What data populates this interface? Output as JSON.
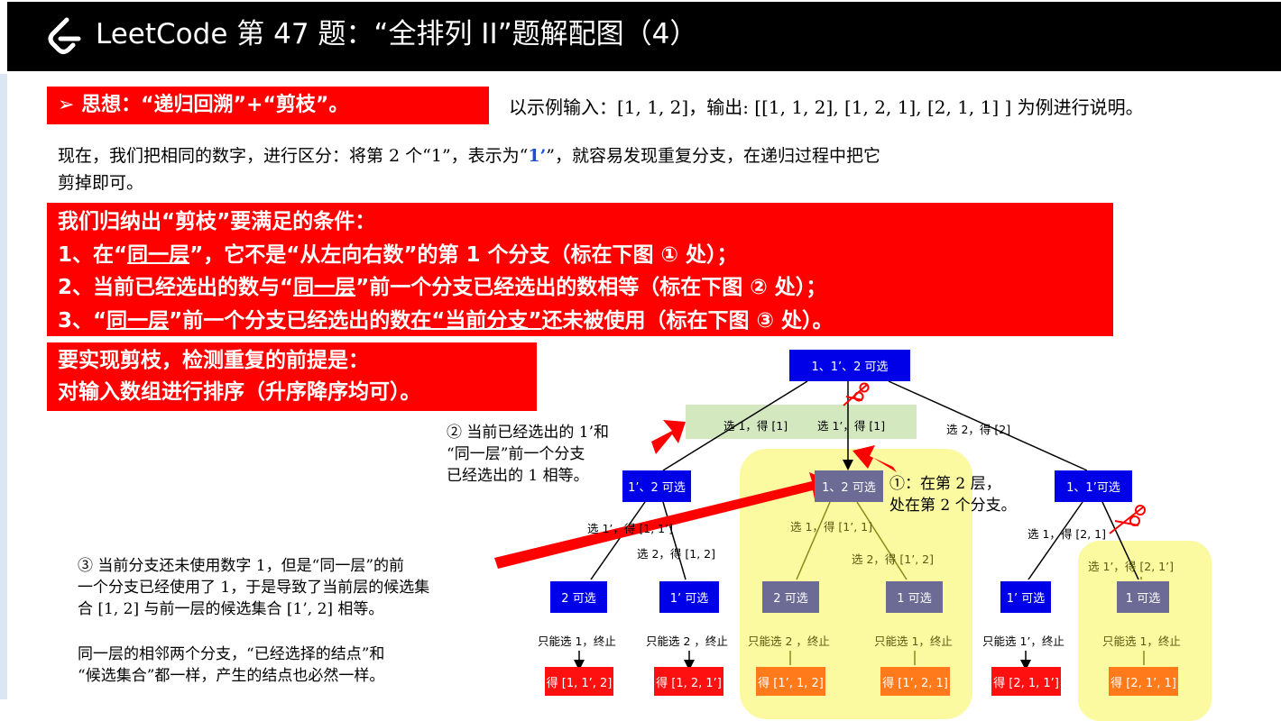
{
  "header": {
    "title": "LeetCode 第 47 题：“全排列 II”题解配图（4）"
  },
  "idea_box": {
    "text": "➢  思想：“递归回溯”+“剪枝”。"
  },
  "example_text": "以示例输入：[1, 1, 2]，输出: [[1, 1, 2],  [1, 2, 1],  [2, 1, 1] ] 为例进行说明。",
  "intro": {
    "line1_a": "现在，我们把相同的数字，进行区分：将第 2 个“1”，表示为“",
    "line1_highlight": "1’",
    "line1_b": "”，就容易发现重复分支，在递归过程中把它",
    "line2": "剪掉即可。"
  },
  "conditions_box": {
    "heading": "我们归纳出“剪枝”要满足的条件：",
    "c1_a": "1、在“",
    "c1_u": "同一层",
    "c1_b": "”，它不是“从左向右数”的第 1 个分支（标在下图 ① 处）；",
    "c2_a": "2、当前已经选出的数与“",
    "c2_u": "同一层",
    "c2_b": "”前一个分支已经选出的数相等（标在下图 ② 处）；",
    "c3_a": "3、“",
    "c3_u1": "同一层",
    "c3_mid": "”前一个分支已经选出的数",
    "c3_u2": "在“当前分支”",
    "c3_b": "还未被使用（标在下图 ③ 处）。"
  },
  "premise_box": {
    "line1": "要实现剪枝，检测重复的前提是：",
    "line2": "对输入数组进行排序（升序降序均可）。"
  },
  "tree": {
    "root": "1、1’、2 可选",
    "level1_edges": [
      "选 1，得 [1]",
      "选 1’，得 [1]",
      "选 2，得 [2]"
    ],
    "level2_nodes": [
      "1’、2 可选",
      "1、2 可选",
      "1、1’可选"
    ],
    "level2_edges": [
      "选 1’，得 [1, 1’]",
      "选 2，得 [1, 2]",
      "选 1，得 [1’, 1]",
      "选 2，得 [1’, 2]",
      "选 1，得 [2, 1]",
      "选 1’，得 [2, 1’]"
    ],
    "level3_nodes": [
      "2 可选",
      "1’ 可选",
      "2 可选",
      "1 可选",
      "1’ 可选",
      "1 可选"
    ],
    "level3_edges": [
      "只能选 1，终止",
      "只能选 2 ，终止",
      "只能选 2 ，终止",
      "只能选 1，终止",
      "只能选 1’，终止",
      "只能选 1，终止"
    ],
    "leaves": [
      "得 [1, 1’, 2]",
      "得 [1, 2, 1’]",
      "得 [1’, 1, 2]",
      "得 [1’, 2, 1]",
      "得 [2, 1, 1’]",
      "得 [2, 1’, 1]"
    ]
  },
  "annotations": {
    "a2_l1": "② 当前已经选出的 1’和",
    "a2_l2": "“同一层”前一个分支",
    "a2_l3": "已经选出的 1 相等。",
    "a1_l1": "①：在第 2 层，",
    "a1_l2": "处在第 2 个分支。",
    "a3_l1": "③ 当前分支还未使用数字 1，但是“同一层”的前",
    "a3_l2": "一个分支已经使用了 1，于是导致了当前层的候选集",
    "a3_l3": "合 [1, 2] 与前一层的候选集合 [1’, 2] 相等。",
    "note_l1": "同一层的相邻两个分支，“已经选择的结点”和",
    "note_l2": "“候选集合”都一样，产生的结点也必然一样。"
  },
  "colors": {
    "header_bg": "#000000",
    "red": "#ff0000",
    "node_blue": "#0000e8",
    "node_grey": "#6b6b96",
    "leaf_orange": "#ff7a1a",
    "highlight_yellow": "#fbfaa0",
    "highlight_green": "#d4e8c0",
    "accent_blue_text": "#1a4fd6"
  }
}
